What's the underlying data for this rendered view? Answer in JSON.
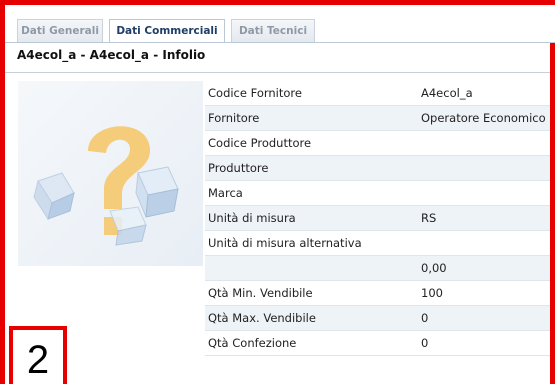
{
  "tabs": [
    {
      "label": "Dati Generali",
      "active": false
    },
    {
      "label": "Dati Commerciali",
      "active": true
    },
    {
      "label": "Dati Tecnici",
      "active": false
    }
  ],
  "product_title": "A4ecol_a - A4ecol_a - Infolio",
  "image": {
    "icon": "question-mark-placeholder-icon"
  },
  "fields": [
    {
      "label": "Codice Fornitore",
      "value": "A4ecol_a"
    },
    {
      "label": "Fornitore",
      "value": "Operatore Economico"
    },
    {
      "label": "Codice Produttore",
      "value": ""
    },
    {
      "label": "Produttore",
      "value": ""
    },
    {
      "label": "Marca",
      "value": ""
    },
    {
      "label": "Unità di misura",
      "value": "RS"
    },
    {
      "label": "Unità di misura alternativa",
      "value": ""
    },
    {
      "label": "",
      "value": "0,00"
    },
    {
      "label": "Qtà Min. Vendibile",
      "value": "100"
    },
    {
      "label": "Qtà Max. Vendibile",
      "value": "0"
    },
    {
      "label": "Qtà Confezione",
      "value": "0"
    }
  ],
  "badge": {
    "number": "2"
  },
  "colors": {
    "frame": "#e60000",
    "tab_active_text": "#1f3e66",
    "row_shade": "#eef3f8"
  }
}
